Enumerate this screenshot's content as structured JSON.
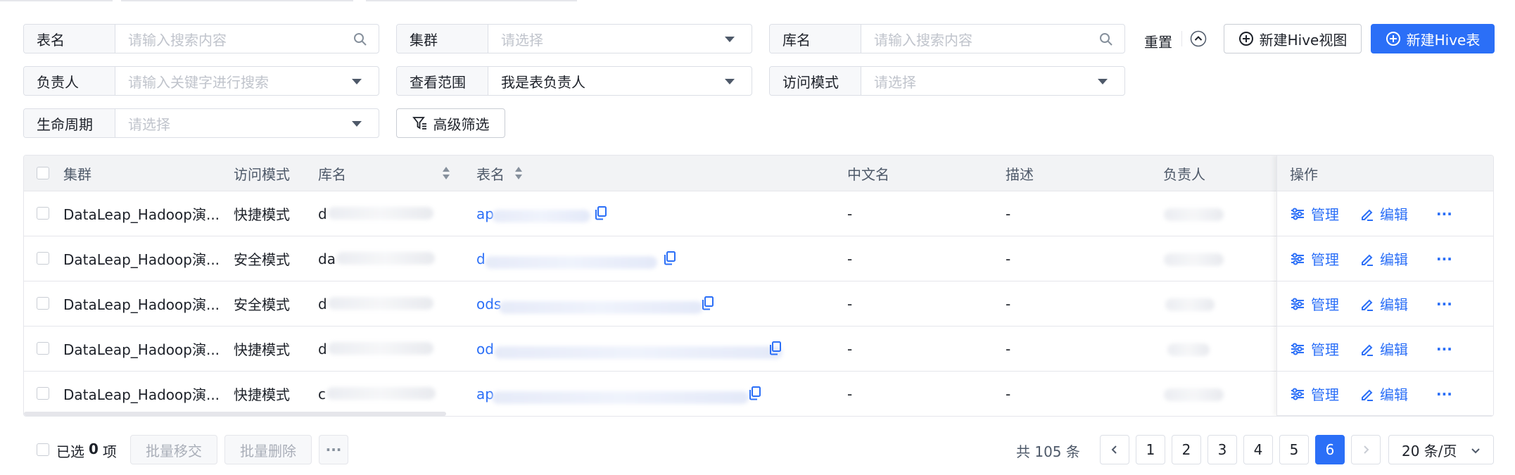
{
  "filters": {
    "table_name": {
      "label": "表名",
      "placeholder": "请输入搜索内容"
    },
    "cluster": {
      "label": "集群",
      "placeholder": "请选择"
    },
    "db_name": {
      "label": "库名",
      "placeholder": "请输入搜索内容"
    },
    "owner": {
      "label": "负责人",
      "placeholder": "请输入关键字进行搜索"
    },
    "scope": {
      "label": "查看范围",
      "value": "我是表负责人"
    },
    "access_mode": {
      "label": "访问模式",
      "placeholder": "请选择"
    },
    "lifecycle": {
      "label": "生命周期",
      "placeholder": "请选择"
    },
    "advanced_label": "高级筛选",
    "reset_label": "重置"
  },
  "actions": {
    "new_view_label": "新建Hive视图",
    "new_table_label": "新建Hive表"
  },
  "table": {
    "columns": {
      "cluster": "集群",
      "access_mode": "访问模式",
      "db": "库名",
      "table": "表名",
      "cn_name": "中文名",
      "desc": "描述",
      "owner": "负责人",
      "ops": "操作"
    },
    "rows": [
      {
        "cluster": "DataLeap_Hadoop演...",
        "mode": "快捷模式",
        "db": "d",
        "table": "ap",
        "cn": "-",
        "desc": "-"
      },
      {
        "cluster": "DataLeap_Hadoop演...",
        "mode": "安全模式",
        "db": "da",
        "table": "d",
        "cn": "-",
        "desc": "-"
      },
      {
        "cluster": "DataLeap_Hadoop演...",
        "mode": "安全模式",
        "db": "d",
        "table": "ods",
        "cn": "-",
        "desc": "-"
      },
      {
        "cluster": "DataLeap_Hadoop演...",
        "mode": "快捷模式",
        "db": "d",
        "table": "od",
        "cn": "-",
        "desc": "-"
      },
      {
        "cluster": "DataLeap_Hadoop演...",
        "mode": "快捷模式",
        "db": "c",
        "table": "ap",
        "cn": "-",
        "desc": "-"
      }
    ],
    "row_actions": {
      "manage": "管理",
      "edit": "编辑",
      "more": "···"
    }
  },
  "footer": {
    "selected_prefix": "已选",
    "selected_count": "0",
    "selected_suffix": "项",
    "batch_move": "批量移交",
    "batch_delete": "批量删除",
    "more": "···",
    "total": "共 105 条",
    "pages": [
      "1",
      "2",
      "3",
      "4",
      "5",
      "6"
    ],
    "current_page": "6",
    "page_size": "20 条/页"
  },
  "colors": {
    "primary": "#2b6ff7",
    "header_bg": "#f2f3f5",
    "border": "#dcdfe6"
  },
  "icons": [
    "search-icon",
    "caret-down-icon",
    "collapse-up-icon",
    "plus-circle-icon",
    "filter-icon",
    "copy-icon",
    "sliders-icon",
    "edit-icon",
    "more-icon",
    "chevron-left-icon",
    "chevron-right-icon",
    "chevron-down-icon"
  ]
}
